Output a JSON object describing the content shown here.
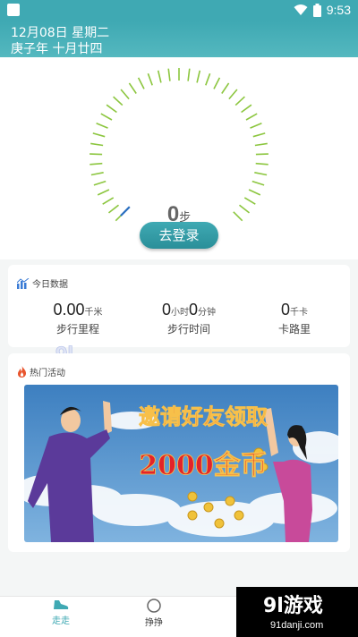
{
  "status_bar": {
    "time": "9:53"
  },
  "header": {
    "date_line": "12月08日 星期二",
    "lunar_line": "庚子年 十月廿四"
  },
  "pedometer": {
    "steps": "0",
    "unit": "步",
    "progress": 0
  },
  "login_button": {
    "label": "去登录"
  },
  "today": {
    "title": "今日数据",
    "stats": [
      {
        "value": "0.00",
        "unit": "千米",
        "label": "步行里程"
      },
      {
        "value_h": "0",
        "unit_h": "小时",
        "value_m": "0",
        "unit_m": "分钟",
        "label": "步行时间"
      },
      {
        "value": "0",
        "unit": "千卡",
        "label": "卡路里"
      }
    ]
  },
  "hot": {
    "title": "热门活动",
    "banner_line1": "邀请好友领取",
    "banner_line2": "2000金币"
  },
  "watermark": {
    "logo": "9l游戏",
    "site": "91danji.com"
  },
  "tabs": [
    {
      "label": "走走"
    },
    {
      "label": "挣挣"
    }
  ],
  "colors": {
    "accent": "#3fa9b3",
    "dial_tick": "#8cc63f",
    "banner_bg": "#4d8ec4",
    "banner_text": "#e2232a"
  }
}
